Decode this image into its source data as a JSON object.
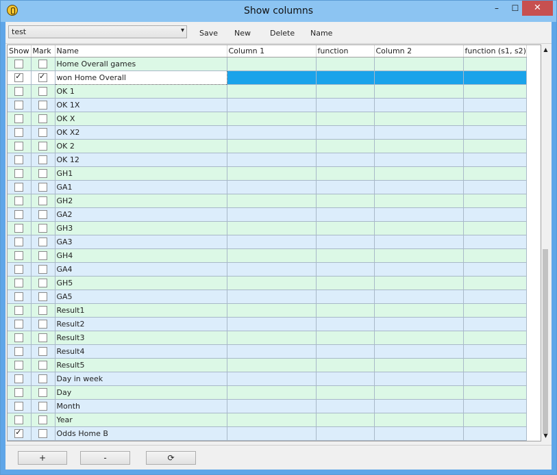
{
  "window": {
    "title": "Show columns",
    "minimize": "–",
    "maximize": "☐",
    "close": "✕"
  },
  "toolbar": {
    "profile_value": "test",
    "save_label": "Save",
    "new_label": "New",
    "delete_label": "Delete",
    "name_label": "Name"
  },
  "table": {
    "columns": [
      "Show",
      "Mark",
      "Name",
      "Column 1",
      "function",
      "Column 2",
      "function (s1, s2)"
    ],
    "rows": [
      {
        "name": "Home Overall games",
        "show": false,
        "mark": false
      },
      {
        "name": "won Home Overall",
        "show": true,
        "mark": true,
        "selected": true
      },
      {
        "name": "OK 1",
        "show": false,
        "mark": false
      },
      {
        "name": "OK 1X",
        "show": false,
        "mark": false
      },
      {
        "name": "OK X",
        "show": false,
        "mark": false
      },
      {
        "name": "OK X2",
        "show": false,
        "mark": false
      },
      {
        "name": "OK 2",
        "show": false,
        "mark": false
      },
      {
        "name": "OK 12",
        "show": false,
        "mark": false
      },
      {
        "name": "GH1",
        "show": false,
        "mark": false
      },
      {
        "name": "GA1",
        "show": false,
        "mark": false
      },
      {
        "name": "GH2",
        "show": false,
        "mark": false
      },
      {
        "name": "GA2",
        "show": false,
        "mark": false
      },
      {
        "name": "GH3",
        "show": false,
        "mark": false
      },
      {
        "name": "GA3",
        "show": false,
        "mark": false
      },
      {
        "name": "GH4",
        "show": false,
        "mark": false
      },
      {
        "name": "GA4",
        "show": false,
        "mark": false
      },
      {
        "name": "GH5",
        "show": false,
        "mark": false
      },
      {
        "name": "GA5",
        "show": false,
        "mark": false
      },
      {
        "name": "Result1",
        "show": false,
        "mark": false
      },
      {
        "name": "Result2",
        "show": false,
        "mark": false
      },
      {
        "name": "Result3",
        "show": false,
        "mark": false
      },
      {
        "name": "Result4",
        "show": false,
        "mark": false
      },
      {
        "name": "Result5",
        "show": false,
        "mark": false
      },
      {
        "name": "Day in week",
        "show": false,
        "mark": false
      },
      {
        "name": "Day",
        "show": false,
        "mark": false
      },
      {
        "name": "Month",
        "show": false,
        "mark": false
      },
      {
        "name": "Year",
        "show": false,
        "mark": false
      },
      {
        "name": "Odds Home B",
        "show": true,
        "mark": false
      }
    ]
  },
  "bottom": {
    "add_label": "+",
    "remove_label": "-",
    "refresh_label": "⟳"
  },
  "colors": {
    "row_green": "#dcf8e6",
    "row_blue": "#dcedfb",
    "selection": "#1aa3ea",
    "titlebar": "#8cc4f2"
  }
}
